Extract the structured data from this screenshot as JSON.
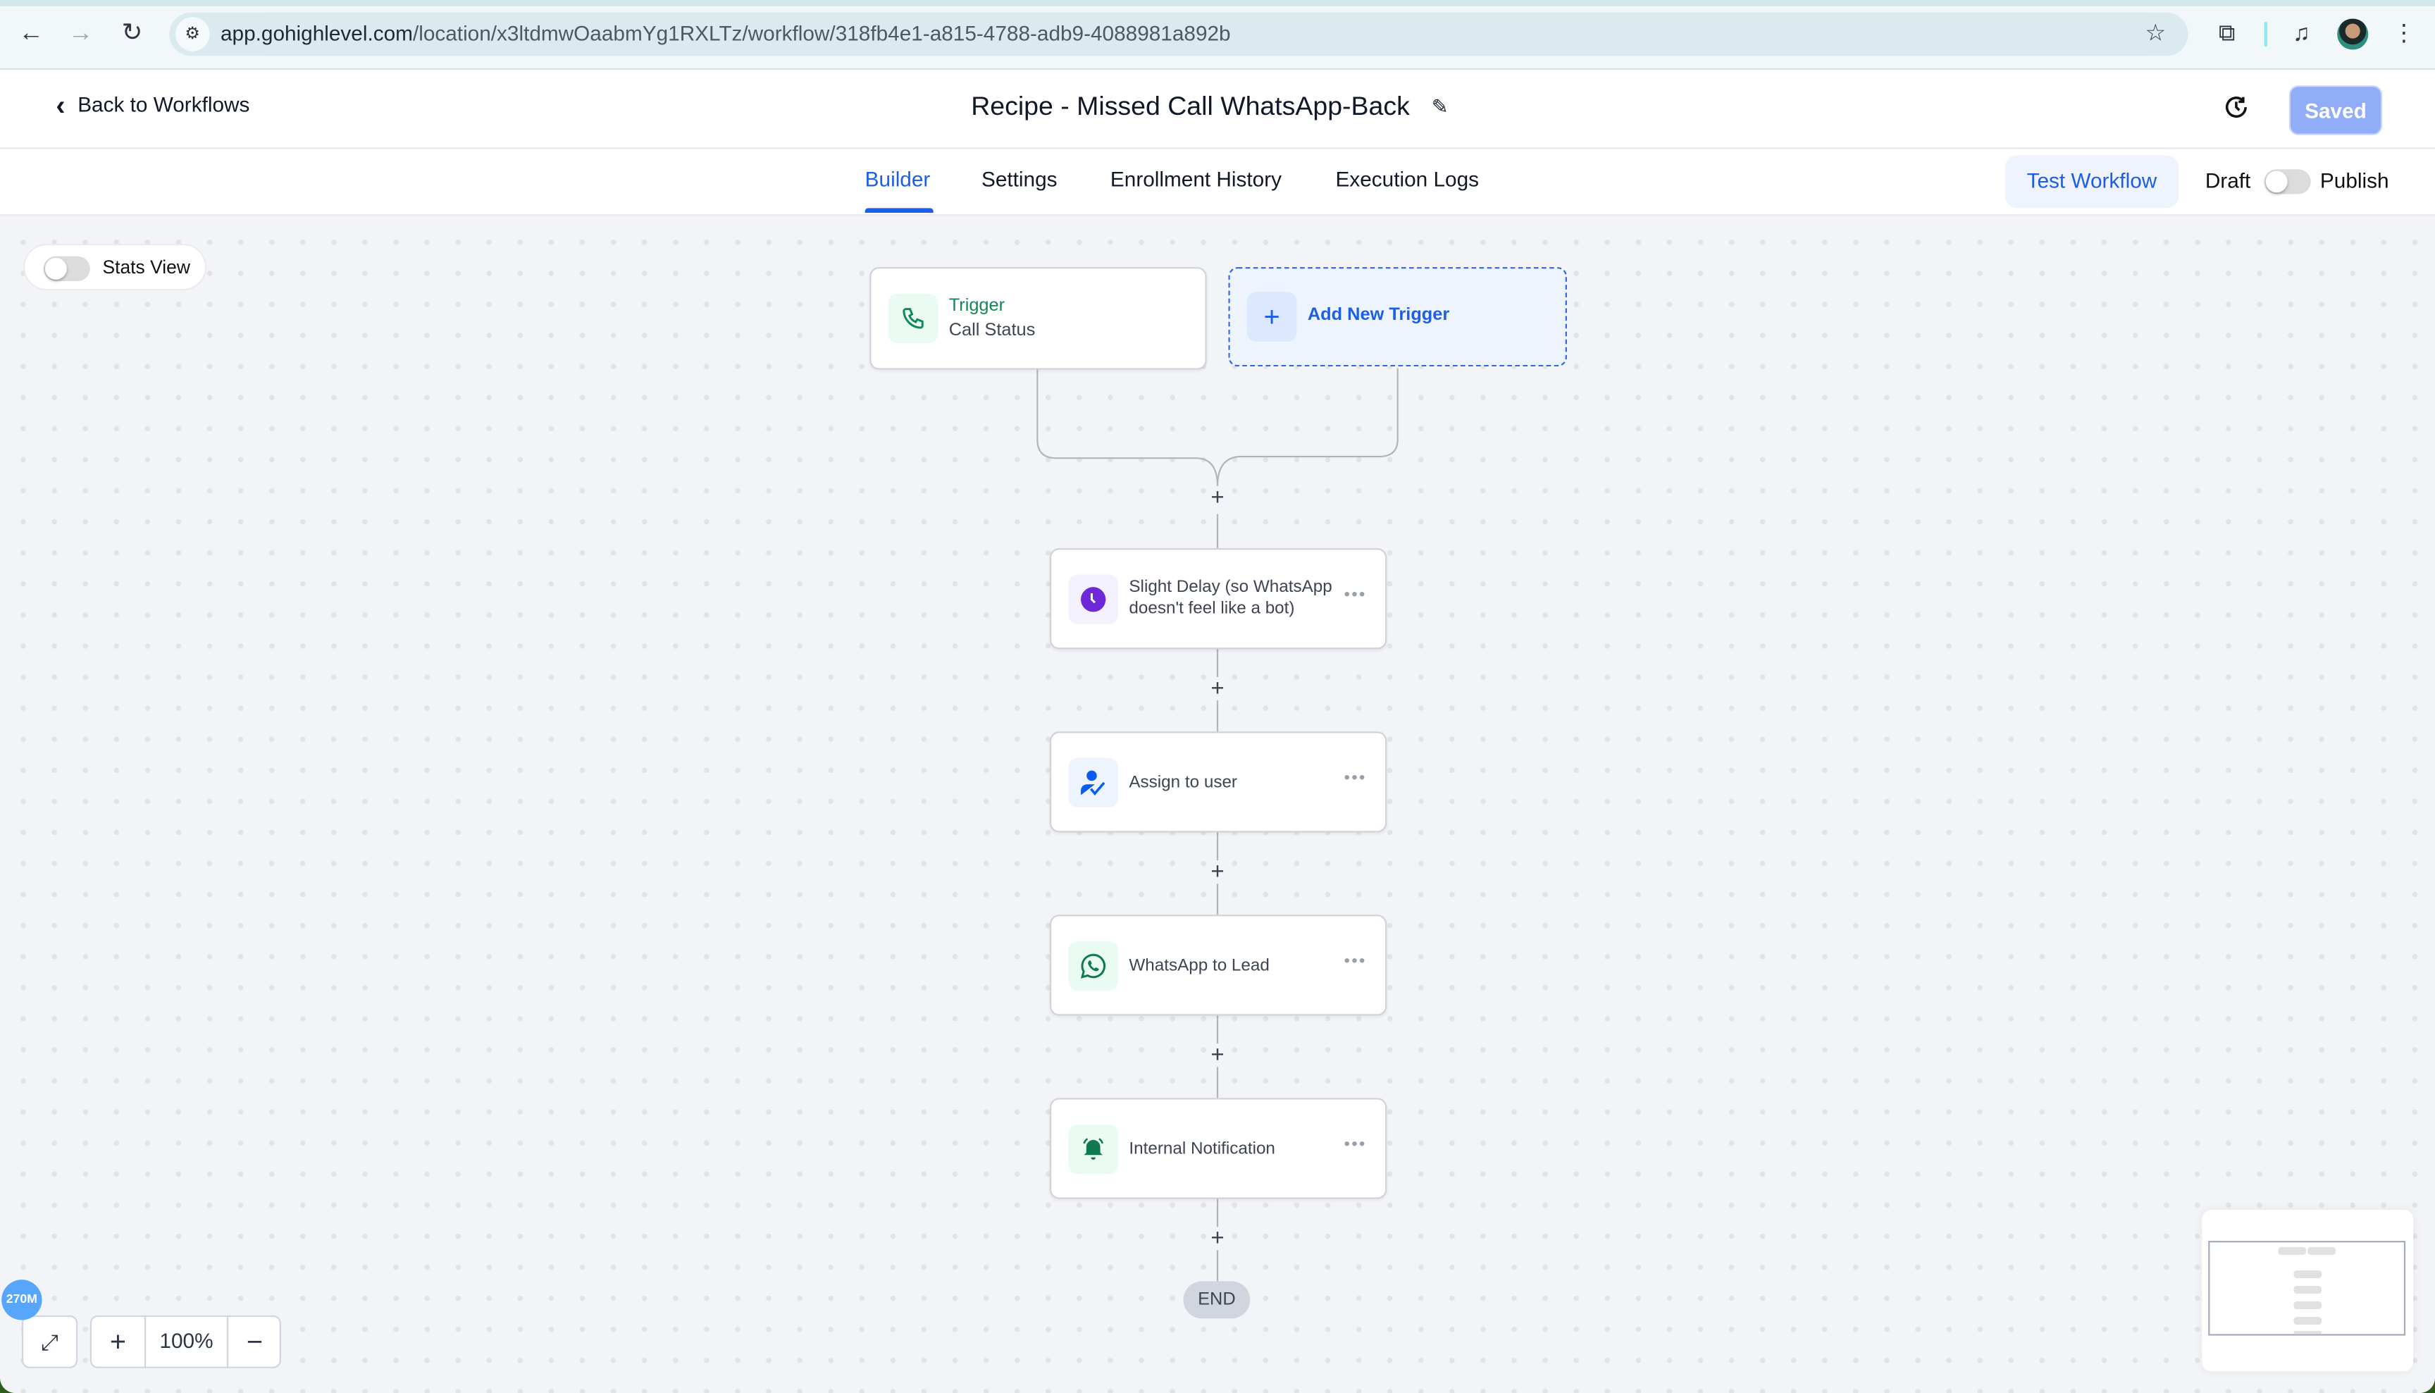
{
  "browser": {
    "url_host": "app.gohighlevel.com",
    "url_path": "/location/x3ltdmwOaabmYg1RXLTz/workflow/318fb4e1-a815-4788-adb9-4088981a892b"
  },
  "header": {
    "back_label": "Back to Workflows",
    "title": "Recipe - Missed Call WhatsApp-Back",
    "saved_label": "Saved"
  },
  "tabs": [
    {
      "label": "Builder",
      "active": true
    },
    {
      "label": "Settings",
      "active": false
    },
    {
      "label": "Enrollment History",
      "active": false
    },
    {
      "label": "Execution Logs",
      "active": false
    }
  ],
  "actions": {
    "test_label": "Test Workflow",
    "draft_label": "Draft",
    "publish_label": "Publish",
    "published": false
  },
  "canvas": {
    "stats_label": "Stats View",
    "stats_on": false,
    "trigger": {
      "title": "Trigger",
      "subtitle": "Call Status"
    },
    "add_trigger_label": "Add New Trigger",
    "steps": [
      {
        "label": "Slight Delay (so WhatsApp doesn't feel like a bot)",
        "icon": "clock-icon"
      },
      {
        "label": "Assign to user",
        "icon": "user-check-icon"
      },
      {
        "label": "WhatsApp to Lead",
        "icon": "whatsapp-icon"
      },
      {
        "label": "Internal Notification",
        "icon": "bell-icon"
      }
    ],
    "end_label": "END",
    "zoom_level": "100%",
    "memory_badge": "270M"
  },
  "colors": {
    "accent": "#1d5ee8",
    "trigger_green": "#0f8a55",
    "delay_purple": "#6d28d9",
    "saved_bg": "#91adf7"
  }
}
